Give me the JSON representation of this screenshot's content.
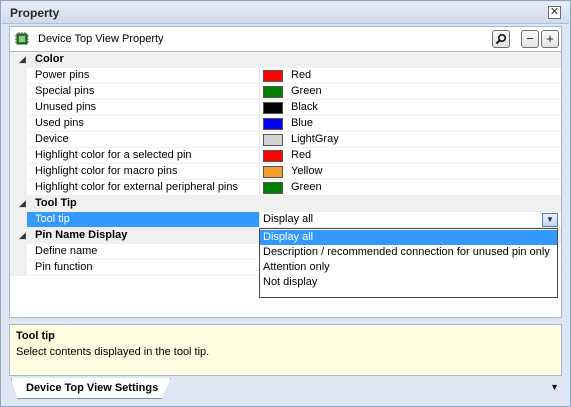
{
  "panel": {
    "title": "Property",
    "close_glyph": "✕"
  },
  "toolbar": {
    "label": "Device Top View Property",
    "search_glyph": "⌕",
    "collapse_glyph": "−",
    "expand_glyph": "+"
  },
  "categories": {
    "color": {
      "label": "Color",
      "arrow": "◢"
    },
    "tooltip": {
      "label": "Tool Tip",
      "arrow": "◢"
    },
    "pinname": {
      "label": "Pin Name Display",
      "arrow": "◢"
    }
  },
  "color_props": [
    {
      "name": "Power pins",
      "value": "Red",
      "swatch": "#ff0000"
    },
    {
      "name": "Special pins",
      "value": "Green",
      "swatch": "#008000"
    },
    {
      "name": "Unused pins",
      "value": "Black",
      "swatch": "#000000"
    },
    {
      "name": "Used pins",
      "value": "Blue",
      "swatch": "#0000ff"
    },
    {
      "name": "Device",
      "value": "LightGray",
      "swatch": "#d3d3d3"
    },
    {
      "name": "Highlight color for a selected pin",
      "value": "Red",
      "swatch": "#ff0000"
    },
    {
      "name": "Highlight color for macro pins",
      "value": "Yellow",
      "swatch": "#f0a030"
    },
    {
      "name": "Highlight color for external peripheral pins",
      "value": "Green",
      "swatch": "#008000"
    }
  ],
  "tooltip_prop": {
    "name": "Tool tip",
    "value": "Display all",
    "dropdown_glyph": "▼"
  },
  "pinname_props": [
    {
      "name": "Define name",
      "value": ""
    },
    {
      "name": "Pin function",
      "value": ""
    }
  ],
  "dropdown_options": [
    "Display all",
    "Description / recommended connection for unused pin only",
    "Attention only",
    "Not display"
  ],
  "description": {
    "title": "Tool tip",
    "text": "Select contents displayed in the tool tip."
  },
  "tabs": {
    "active": "Device Top View Settings",
    "menu_glyph": "▼"
  }
}
